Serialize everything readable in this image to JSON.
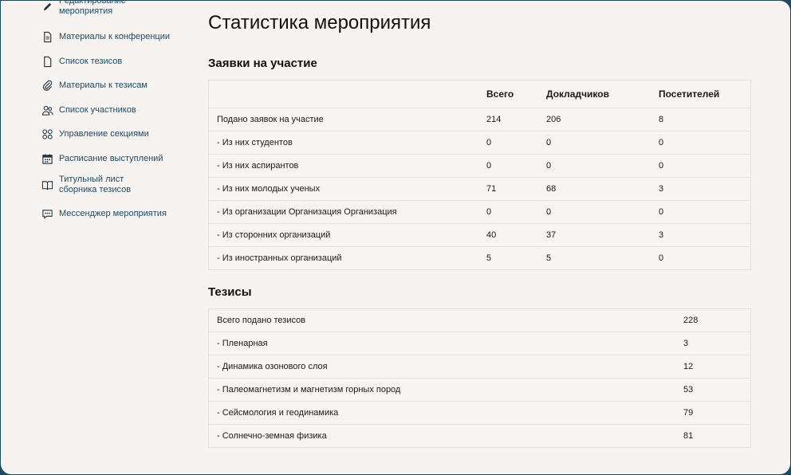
{
  "sidebar": {
    "items": [
      {
        "label": "Редактирование мероприятия",
        "icon": "pencil-icon"
      },
      {
        "label": "Материалы к конференции",
        "icon": "document-icon"
      },
      {
        "label": "Список тезисов",
        "icon": "file-icon"
      },
      {
        "label": "Материалы к тезисам",
        "icon": "paperclip-icon"
      },
      {
        "label": "Список участников",
        "icon": "users-icon"
      },
      {
        "label": "Управление секциями",
        "icon": "grid-circles-icon"
      },
      {
        "label": "Расписание выступлений",
        "icon": "calendar-icon"
      },
      {
        "label": "Титульный лист сборника тезисов",
        "icon": "book-icon"
      },
      {
        "label": "Мессенджер мероприятия",
        "icon": "chat-icon"
      }
    ]
  },
  "page": {
    "title": "Статистика мероприятия"
  },
  "applications": {
    "heading": "Заявки на участие",
    "columns": [
      "",
      "Всего",
      "Докладчиков",
      "Посетителей"
    ],
    "rows": [
      [
        "Подано заявок на участие",
        "214",
        "206",
        "8"
      ],
      [
        "- Из них студентов",
        "0",
        "0",
        "0"
      ],
      [
        "- Из них аспирантов",
        "0",
        "0",
        "0"
      ],
      [
        "- Из них молодых ученых",
        "71",
        "68",
        "3"
      ],
      [
        "- Из организации Организация Организация",
        "0",
        "0",
        "0"
      ],
      [
        "- Из сторонних организаций",
        "40",
        "37",
        "3"
      ],
      [
        "- Из иностранных организаций",
        "5",
        "5",
        "0"
      ]
    ]
  },
  "theses": {
    "heading": "Тезисы",
    "rows": [
      [
        "Всего подано тезисов",
        "228"
      ],
      [
        "- Пленарная",
        "3"
      ],
      [
        "- Динамика озонового слоя",
        "12"
      ],
      [
        "- Палеомагнетизм и магнетизм горных пород",
        "53"
      ],
      [
        "- Сейсмология и геодинамика",
        "79"
      ],
      [
        "- Солнечно-земная физика",
        "81"
      ]
    ]
  }
}
